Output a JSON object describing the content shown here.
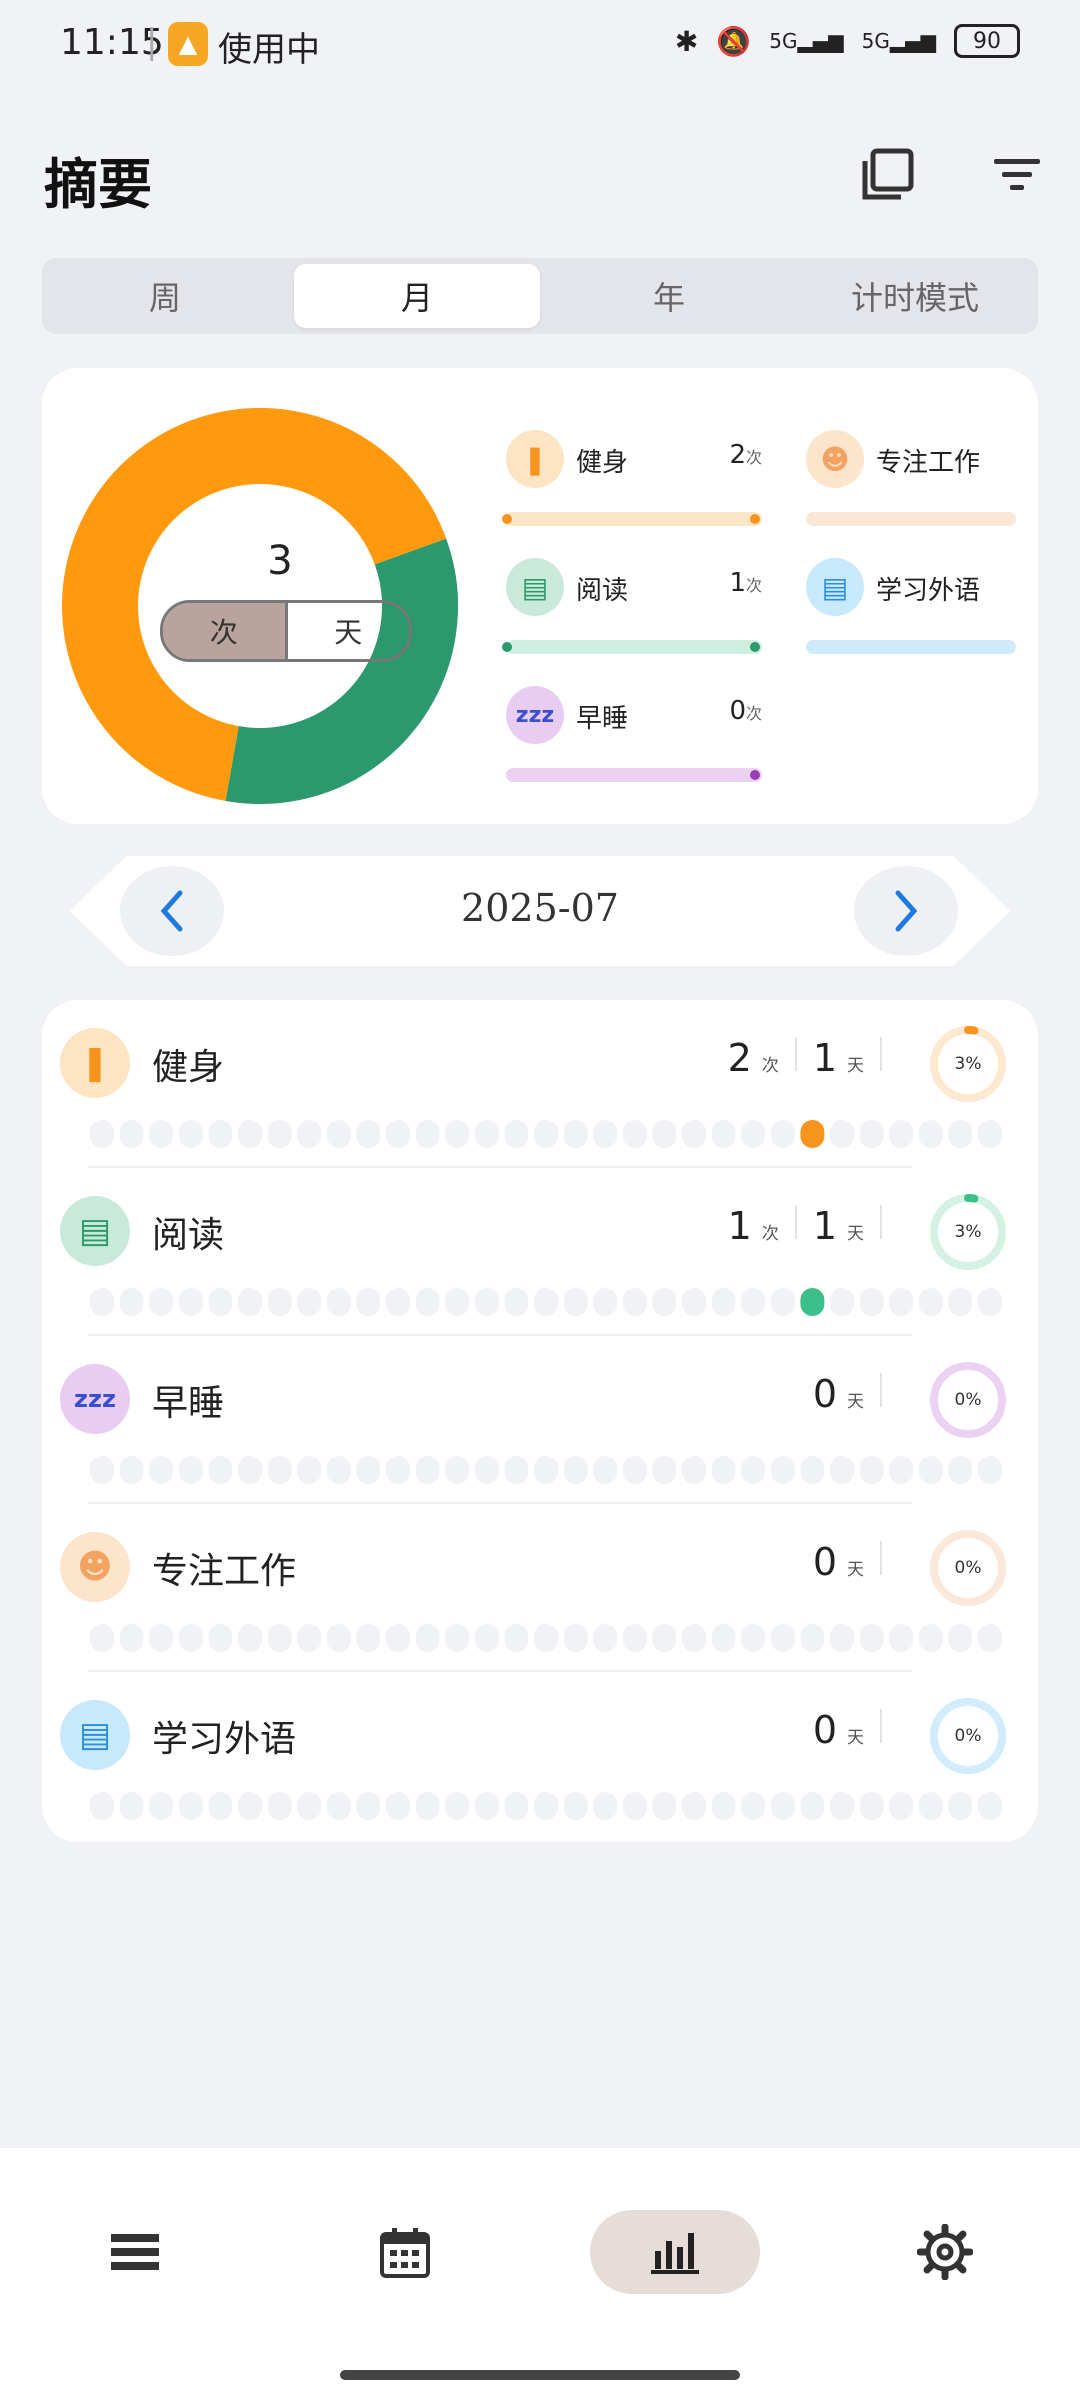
{
  "status": {
    "time": "11:15",
    "in_use": "使用中",
    "battery": "90",
    "net1": "5G",
    "net2": "5G"
  },
  "page": {
    "title": "摘要"
  },
  "tabs": [
    {
      "label": "周",
      "active": false
    },
    {
      "label": "月",
      "active": true
    },
    {
      "label": "年",
      "active": false
    },
    {
      "label": "计时模式",
      "active": false
    }
  ],
  "summary": {
    "total": "3",
    "toggle": {
      "left": "次",
      "right": "天",
      "selected": "次"
    },
    "legend": [
      {
        "label": "健身",
        "count": "2",
        "unit": "次",
        "color": "#f7941d",
        "track": "#fde6c8",
        "icon": "fitness-icon"
      },
      {
        "label": "专注工作",
        "count": "",
        "unit": "",
        "color": "#f4a25f",
        "track": "#fbe7d5",
        "icon": "focus-work-icon"
      },
      {
        "label": "阅读",
        "count": "1",
        "unit": "次",
        "color": "#2a9a6a",
        "track": "#cdeee0",
        "icon": "reading-icon"
      },
      {
        "label": "学习外语",
        "count": "",
        "unit": "",
        "color": "#2a8fdc",
        "track": "#cfeafc",
        "icon": "language-icon"
      },
      {
        "label": "早睡",
        "count": "0",
        "unit": "次",
        "color": "#9b3fb0",
        "track": "#ecd1f3",
        "icon": "sleep-icon"
      }
    ]
  },
  "chart_data": {
    "type": "pie",
    "categories": [
      "健身",
      "阅读",
      "早睡"
    ],
    "values": [
      2,
      1,
      0
    ],
    "colors": [
      "#ff9a0e",
      "#2b986d",
      "#9b3fb0"
    ]
  },
  "date_nav": {
    "label": "2025-07"
  },
  "habits": [
    {
      "name": "健身",
      "times": "2",
      "times_unit": "次",
      "days": "1",
      "days_unit": "天",
      "percent": "3%",
      "pct_value": 0.03,
      "color": "#f7941d",
      "icon_bg": "#fde4c2",
      "ring_track": "#fde9cf",
      "active_day": 24,
      "icon": "fitness-icon"
    },
    {
      "name": "阅读",
      "times": "1",
      "times_unit": "次",
      "days": "1",
      "days_unit": "天",
      "percent": "3%",
      "pct_value": 0.03,
      "color": "#3cbf8a",
      "icon_bg": "#c9eadb",
      "ring_track": "#d4f1e4",
      "active_day": 24,
      "icon": "reading-icon"
    },
    {
      "name": "早睡",
      "times": "",
      "times_unit": "",
      "days": "0",
      "days_unit": "天",
      "percent": "0%",
      "pct_value": 0,
      "color": "#9b3fb0",
      "icon_bg": "#e9ccf2",
      "ring_track": "#ebd2f3",
      "active_day": -1,
      "icon": "sleep-icon"
    },
    {
      "name": "专注工作",
      "times": "",
      "times_unit": "",
      "days": "0",
      "days_unit": "天",
      "percent": "0%",
      "pct_value": 0,
      "color": "#f4a25f",
      "icon_bg": "#fde4cc",
      "ring_track": "#fbe8da",
      "active_day": -1,
      "icon": "focus-work-icon"
    },
    {
      "name": "学习外语",
      "times": "",
      "times_unit": "",
      "days": "0",
      "days_unit": "天",
      "percent": "0%",
      "pct_value": 0,
      "color": "#2a8fdc",
      "icon_bg": "#c8e8fb",
      "ring_track": "#d3ecfb",
      "active_day": -1,
      "icon": "language-icon"
    }
  ],
  "bottom_nav": [
    {
      "icon": "list-icon",
      "active": false
    },
    {
      "icon": "calendar-icon",
      "active": false
    },
    {
      "icon": "chart-icon",
      "active": true
    },
    {
      "icon": "gear-icon",
      "active": false
    }
  ]
}
